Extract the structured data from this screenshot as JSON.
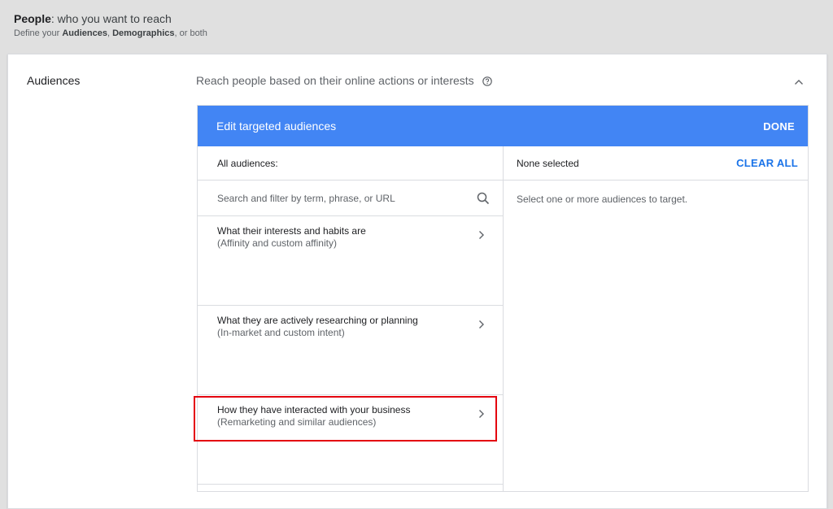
{
  "header": {
    "title_bold": "People",
    "title_rest": ": who you want to reach",
    "subtitle_prefix": "Define your ",
    "subtitle_bold1": "Audiences",
    "subtitle_sep": ", ",
    "subtitle_bold2": "Demographics",
    "subtitle_suffix": ", or both"
  },
  "section": {
    "label": "Audiences",
    "description": "Reach people based on their online actions or interests"
  },
  "panel": {
    "title": "Edit targeted audiences",
    "done_label": "DONE",
    "left": {
      "heading": "All audiences:",
      "search_placeholder": "Search and filter by term, phrase, or URL",
      "categories": [
        {
          "title": "What their interests and habits are",
          "subtitle": "(Affinity and custom affinity)"
        },
        {
          "title": "What they are actively researching or planning",
          "subtitle": "(In-market and custom intent)"
        },
        {
          "title": "How they have interacted with your business",
          "subtitle": "(Remarketing and similar audiences)"
        }
      ]
    },
    "right": {
      "heading": "None selected",
      "clear_all_label": "CLEAR ALL",
      "empty_hint": "Select one or more audiences to target."
    }
  },
  "colors": {
    "accent": "#4285f4",
    "link": "#1a73e8",
    "highlight": "#e4000f"
  }
}
